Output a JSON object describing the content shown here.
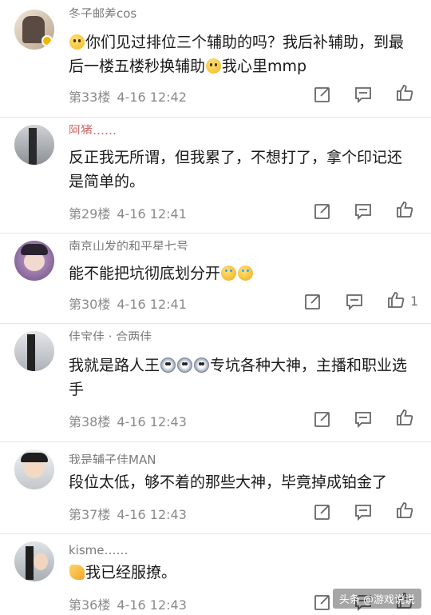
{
  "comments": [
    {
      "username": "冬子邮差cos",
      "text_before": "",
      "emoji1": "smile",
      "text": "你们见过排位三个辅助的吗？我后补辅助，到最后一楼五楼秒换辅助",
      "emoji2": "smile",
      "text_after": "我心里mmp",
      "floor": "第33楼",
      "time": "4-16 12:42",
      "likes": ""
    },
    {
      "username": "阿猪……",
      "text": "反正我无所谓，但我累了，不想打了，拿个印记还是简单的。",
      "floor": "第29楼",
      "time": "4-16 12:41",
      "likes": ""
    },
    {
      "username": "南京山发的和平星七号",
      "text": "能不能把坑彻底划分开",
      "emoji1": "laugh",
      "emoji2": "laugh",
      "floor": "第30楼",
      "time": "4-16 12:41",
      "likes": "1"
    },
    {
      "username": "佳宝佳 · 合两佳",
      "text_a": "我就是路人王",
      "text_b": "专坑各种大神，主播和职业选手",
      "floor": "第38楼",
      "time": "4-16 12:43",
      "likes": ""
    },
    {
      "username": "我是辅子佳MAN",
      "text": "段位太低，够不着的那些大神，毕竟掉成铂金了",
      "floor": "第37楼",
      "time": "4-16 12:43",
      "likes": ""
    },
    {
      "username": "kisme……",
      "text": "我已经服撩。",
      "emoji1": "hand",
      "floor": "第36楼",
      "time": "4-16 12:43",
      "likes": ""
    }
  ],
  "watermark": "头条 @游戏说说",
  "icons": {
    "edit": "edit-icon",
    "comment": "comment-icon",
    "like": "thumbs-up-icon"
  }
}
